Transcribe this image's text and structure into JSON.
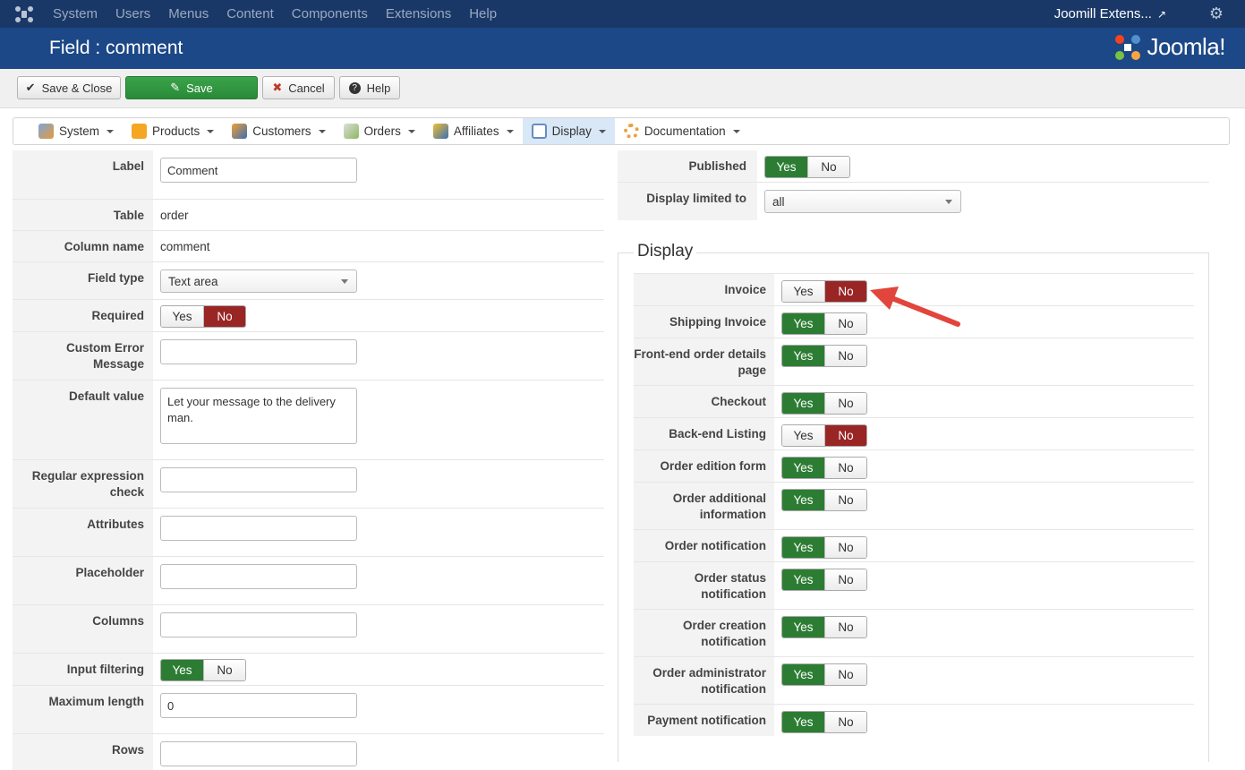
{
  "topbar": {
    "menu": [
      "System",
      "Users",
      "Menus",
      "Content",
      "Components",
      "Extensions",
      "Help"
    ],
    "site_name": "Joomill Extens...",
    "external_icon": "external-link-icon",
    "settings_icon": "gear-icon"
  },
  "title": "Field : comment",
  "brand": "Joomla!",
  "toolbar": {
    "save_close": "Save & Close",
    "save": "Save",
    "cancel": "Cancel",
    "help": "Help"
  },
  "subnav": [
    {
      "label": "System",
      "icon": "wrench-icon"
    },
    {
      "label": "Products",
      "icon": "box-icon"
    },
    {
      "label": "Customers",
      "icon": "users-icon"
    },
    {
      "label": "Orders",
      "icon": "order-icon"
    },
    {
      "label": "Affiliates",
      "icon": "affiliates-icon"
    },
    {
      "label": "Display",
      "icon": "display-icon"
    },
    {
      "label": "Documentation",
      "icon": "help-ring-icon"
    }
  ],
  "left": {
    "label_label": "Label",
    "label_value": "Comment",
    "table_label": "Table",
    "table_value": "order",
    "column_label": "Column name",
    "column_value": "comment",
    "fieldtype_label": "Field type",
    "fieldtype_value": "Text area",
    "required_label": "Required",
    "custom_error_label": "Custom Error Message",
    "default_label": "Default value",
    "default_value": "Let your message to the delivery man.",
    "regex_label": "Regular expression check",
    "attributes_label": "Attributes",
    "placeholder_label": "Placeholder",
    "columns_label": "Columns",
    "filter_label": "Input filtering",
    "maxlen_label": "Maximum length",
    "maxlen_value": "0",
    "rows_label": "Rows"
  },
  "yn": {
    "yes": "Yes",
    "no": "No"
  },
  "right": {
    "published_label": "Published",
    "limited_label": "Display limited to",
    "limited_value": "all",
    "display_legend": "Display"
  },
  "display_rows": [
    {
      "label": "Invoice",
      "value": "No"
    },
    {
      "label": "Shipping Invoice",
      "value": "Yes"
    },
    {
      "label": "Front-end order details page",
      "value": "Yes"
    },
    {
      "label": "Checkout",
      "value": "Yes"
    },
    {
      "label": "Back-end Listing",
      "value": "No"
    },
    {
      "label": "Order edition form",
      "value": "Yes"
    },
    {
      "label": "Order additional information",
      "value": "Yes"
    },
    {
      "label": "Order notification",
      "value": "Yes"
    },
    {
      "label": "Order status notification",
      "value": "Yes"
    },
    {
      "label": "Order creation notification",
      "value": "Yes"
    },
    {
      "label": "Order administrator notification",
      "value": "Yes"
    },
    {
      "label": "Payment notification",
      "value": "Yes"
    }
  ],
  "colors": {
    "yes_active": "#2c7d33",
    "no_active": "#992525",
    "header": "#1c4887",
    "topbar": "#1a3867",
    "annotation_arrow": "#e2453c"
  }
}
